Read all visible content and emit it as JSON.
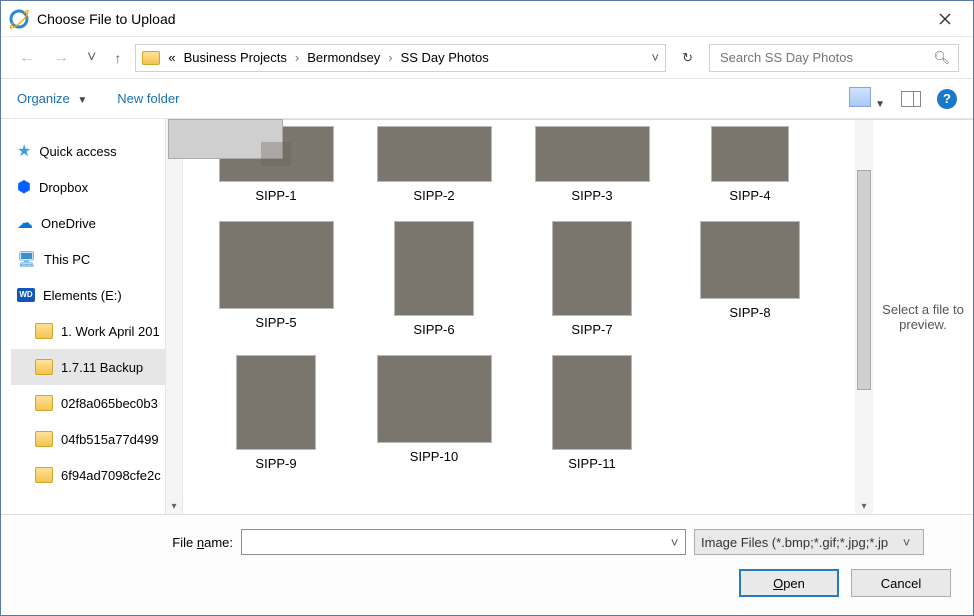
{
  "title": "Choose File to Upload",
  "breadcrumbs": {
    "prefix": "«",
    "part1": "Business Projects",
    "part2": "Bermondsey",
    "part3": "SS Day Photos"
  },
  "search": {
    "placeholder": "Search SS Day Photos"
  },
  "toolbar": {
    "organize": "Organize",
    "new_folder": "New folder",
    "help_glyph": "?"
  },
  "tree": {
    "quick_access": "Quick access",
    "dropbox": "Dropbox",
    "onedrive": "OneDrive",
    "this_pc": "This PC",
    "elements": "Elements (E:)",
    "f1": "1. Work April 201",
    "f2": "1.7.11 Backup",
    "f3": "02f8a065bec0b3",
    "f4": "04fb515a77d499",
    "f5": "6f94ad7098cfe2c"
  },
  "files": {
    "f1": "SIPP-1",
    "f2": "SIPP-2",
    "f3": "SIPP-3",
    "f4": "SIPP-4",
    "f5": "SIPP-5",
    "f6": "SIPP-6",
    "f7": "SIPP-7",
    "f8": "SIPP-8",
    "f9": "SIPP-9",
    "f10": "SIPP-10",
    "f11": "SIPP-11"
  },
  "preview_text": "Select a file to preview.",
  "footer": {
    "filename_label_pre": "File ",
    "filename_label_u": "n",
    "filename_label_post": "ame:",
    "filetype": "Image Files (*.bmp;*.gif;*.jpg;*.jp",
    "open_u": "O",
    "open_rest": "pen",
    "cancel": "Cancel"
  }
}
